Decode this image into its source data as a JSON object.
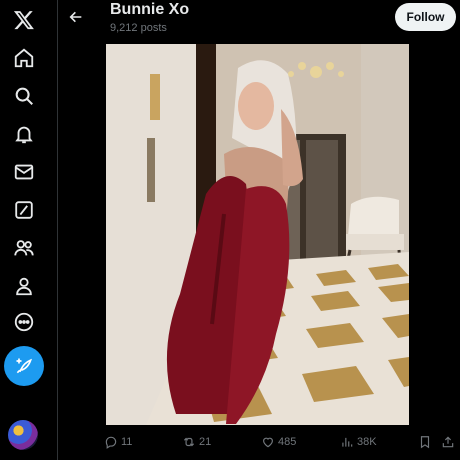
{
  "app": {
    "logo": "x-logo-icon"
  },
  "nav": {
    "items": [
      {
        "name": "home",
        "icon": "home-icon"
      },
      {
        "name": "explore",
        "icon": "search-icon"
      },
      {
        "name": "notifications",
        "icon": "bell-icon"
      },
      {
        "name": "messages",
        "icon": "mail-icon"
      },
      {
        "name": "grok",
        "icon": "slash-square-icon"
      },
      {
        "name": "communities",
        "icon": "people-icon"
      },
      {
        "name": "profile",
        "icon": "person-icon"
      },
      {
        "name": "more",
        "icon": "more-circle-icon"
      }
    ],
    "compose_icon": "feather-plus-icon"
  },
  "header": {
    "title": "Bunnie Xo",
    "posts_count": "9,212 posts",
    "follow_label": "Follow"
  },
  "media": {
    "description_icon": "photo"
  },
  "actions": {
    "replies": "11",
    "reposts": "21",
    "likes": "485",
    "views": "38K"
  },
  "colors": {
    "accent": "#1d9bf0",
    "background": "#000000",
    "text": "#e7e9ea",
    "muted": "#71767b"
  }
}
